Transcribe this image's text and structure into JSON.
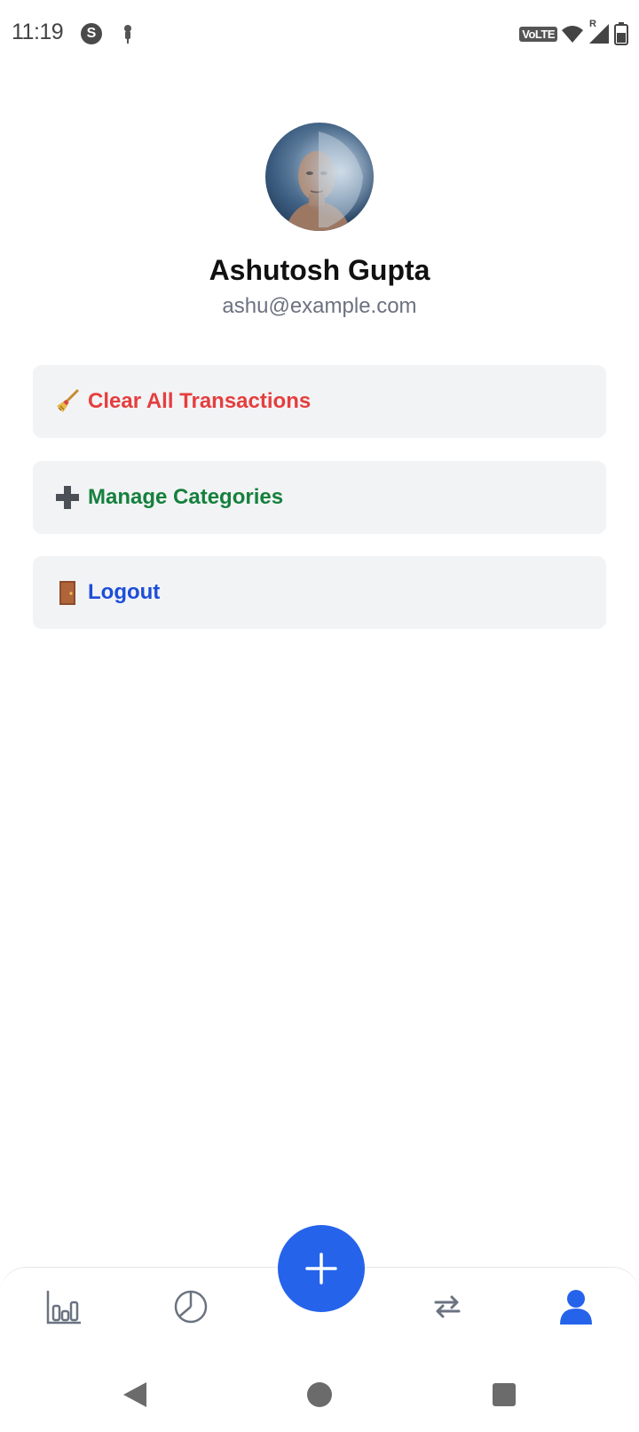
{
  "status_bar": {
    "time": "11:19",
    "app_icon_letter": "S",
    "network_label": "VoLTE",
    "roaming_label": "R"
  },
  "profile": {
    "name": "Ashutosh Gupta",
    "email": "ashu@example.com"
  },
  "actions": [
    {
      "label": "Clear All Transactions",
      "icon": "broom-icon",
      "emoji": "🧹",
      "color": "#e53e3e"
    },
    {
      "label": "Manage Categories",
      "icon": "plus-icon",
      "emoji": "➕",
      "color": "#15803d"
    },
    {
      "label": "Logout",
      "icon": "door-icon",
      "emoji": "🚪",
      "color": "#1d4ed8"
    }
  ],
  "bottom_nav": {
    "items": [
      "bar-chart-icon",
      "pie-chart-icon",
      "transfer-icon",
      "profile-icon"
    ],
    "active": "profile-icon",
    "active_color": "#2563eb",
    "inactive_color": "#6b7280",
    "fab_icon": "plus-icon",
    "fab_color": "#2563eb"
  },
  "system_nav": {
    "buttons": [
      "back-icon",
      "home-icon",
      "recents-icon"
    ]
  }
}
